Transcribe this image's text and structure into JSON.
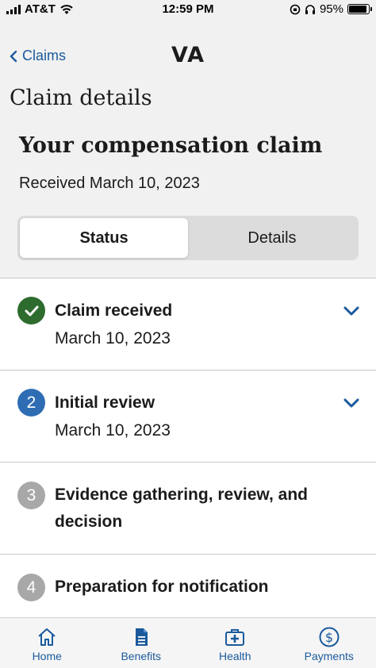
{
  "status_bar": {
    "carrier": "AT&T",
    "time": "12:59 PM",
    "battery": "95%"
  },
  "nav": {
    "back_label": "Claims",
    "title": "VA"
  },
  "page_title": "Claim details",
  "claim": {
    "title": "Your compensation claim",
    "received": "Received March 10, 2023"
  },
  "segment": {
    "tabs": [
      "Status",
      "Details"
    ],
    "selected": "Status"
  },
  "steps": [
    {
      "number": "1",
      "title": "Claim received",
      "date": "March 10, 2023",
      "state": "complete"
    },
    {
      "number": "2",
      "title": "Initial review",
      "date": "March 10, 2023",
      "state": "current"
    },
    {
      "number": "3",
      "title_line1": "Evidence gathering, review, and",
      "title_line2": "decision",
      "state": "pending"
    },
    {
      "number": "4",
      "title": "Preparation for notification",
      "state": "pending"
    }
  ],
  "tabbar": [
    {
      "label": "Home",
      "icon": "home-icon"
    },
    {
      "label": "Benefits",
      "icon": "document-icon"
    },
    {
      "label": "Health",
      "icon": "medical-kit-icon"
    },
    {
      "label": "Payments",
      "icon": "dollar-circle-icon"
    }
  ],
  "colors": {
    "link": "#1a5a9c",
    "complete": "#2e6b2e",
    "current": "#2e6db4",
    "pending": "#a8a8a8"
  }
}
